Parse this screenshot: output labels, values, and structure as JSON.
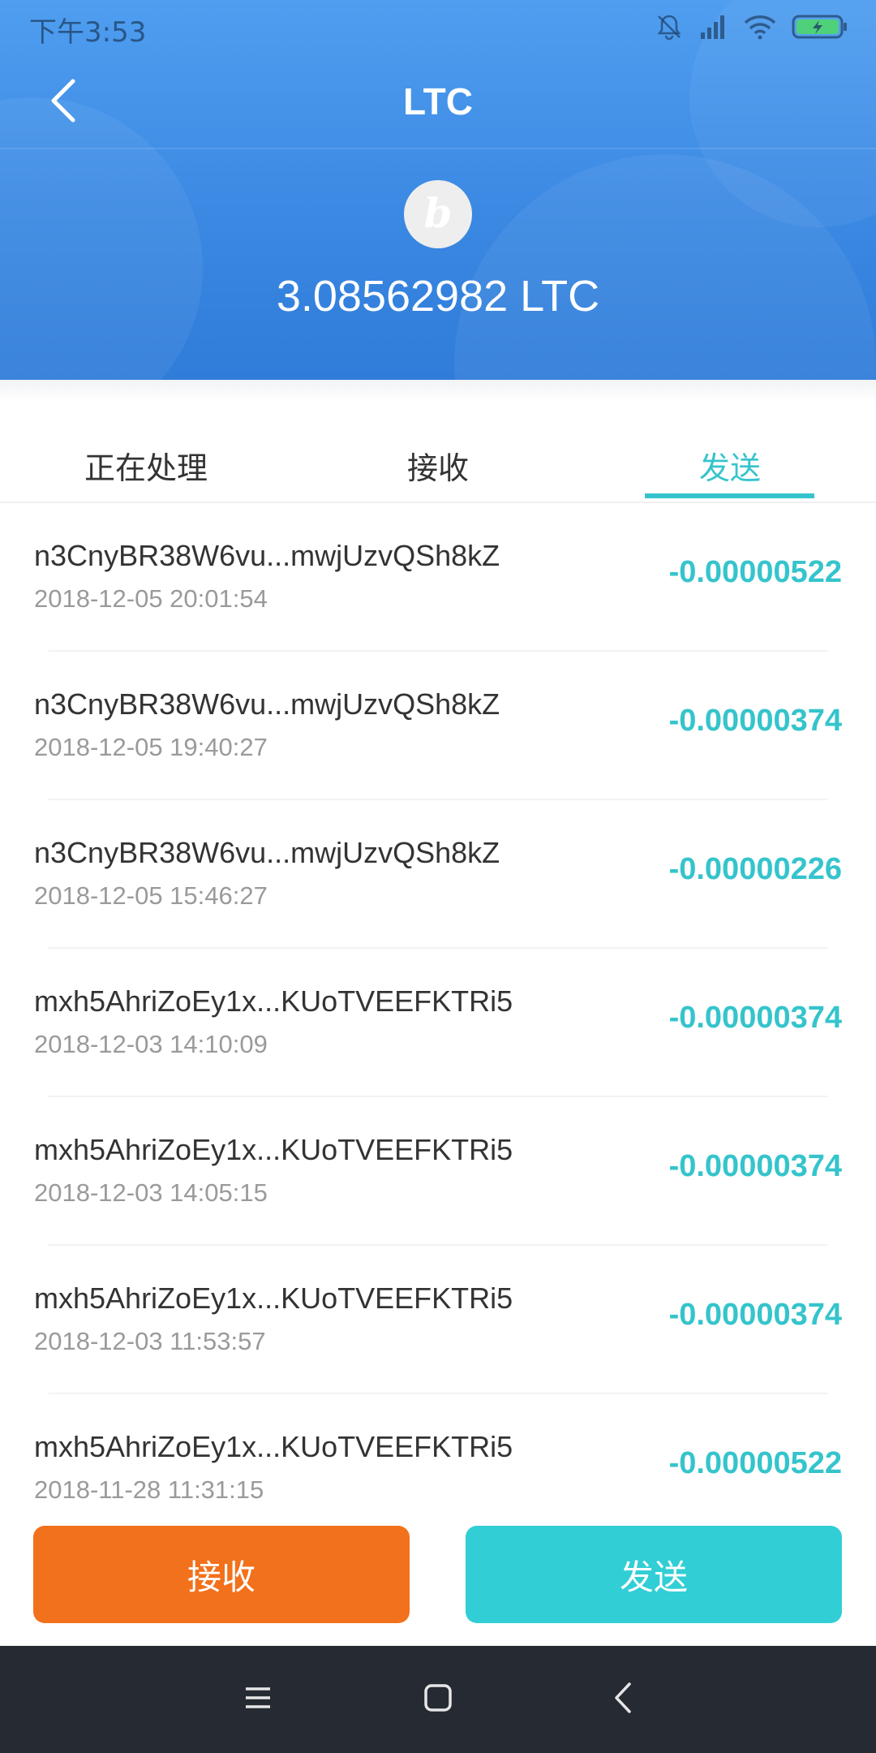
{
  "status_bar": {
    "time": "下午3:53",
    "icons": [
      "mute-bell-icon",
      "signal-icon",
      "wifi-icon",
      "battery-charging-icon"
    ]
  },
  "header": {
    "title": "LTC",
    "back_icon": "chevron-left-icon",
    "coin_logo_glyph": "b",
    "balance": "3.08562982 LTC"
  },
  "tabs": [
    {
      "label": "正在处理",
      "active": false
    },
    {
      "label": "接收",
      "active": false
    },
    {
      "label": "发送",
      "active": true
    }
  ],
  "transactions": [
    {
      "address": "n3CnyBR38W6vu...mwjUzvQSh8kZ",
      "time": "2018-12-05 20:01:54",
      "amount": "-0.00000522"
    },
    {
      "address": "n3CnyBR38W6vu...mwjUzvQSh8kZ",
      "time": "2018-12-05 19:40:27",
      "amount": "-0.00000374"
    },
    {
      "address": "n3CnyBR38W6vu...mwjUzvQSh8kZ",
      "time": "2018-12-05 15:46:27",
      "amount": "-0.00000226"
    },
    {
      "address": "mxh5AhriZoEy1x...KUoTVEEFKTRi5",
      "time": "2018-12-03 14:10:09",
      "amount": "-0.00000374"
    },
    {
      "address": "mxh5AhriZoEy1x...KUoTVEEFKTRi5",
      "time": "2018-12-03 14:05:15",
      "amount": "-0.00000374"
    },
    {
      "address": "mxh5AhriZoEy1x...KUoTVEEFKTRi5",
      "time": "2018-12-03 11:53:57",
      "amount": "-0.00000374"
    },
    {
      "address": "mxh5AhriZoEy1x...KUoTVEEFKTRi5",
      "time": "2018-11-28 11:31:15",
      "amount": "-0.00000522"
    }
  ],
  "actions": {
    "receive_label": "接收",
    "send_label": "发送"
  },
  "android_nav": {
    "icons": [
      "menu-icon",
      "home-icon",
      "back-icon"
    ]
  },
  "colors": {
    "header_blue": "#3b89e3",
    "accent_teal": "#35c4cc",
    "receive_orange": "#f2711c",
    "send_teal": "#32ced6",
    "nav_dark": "#262a32"
  }
}
